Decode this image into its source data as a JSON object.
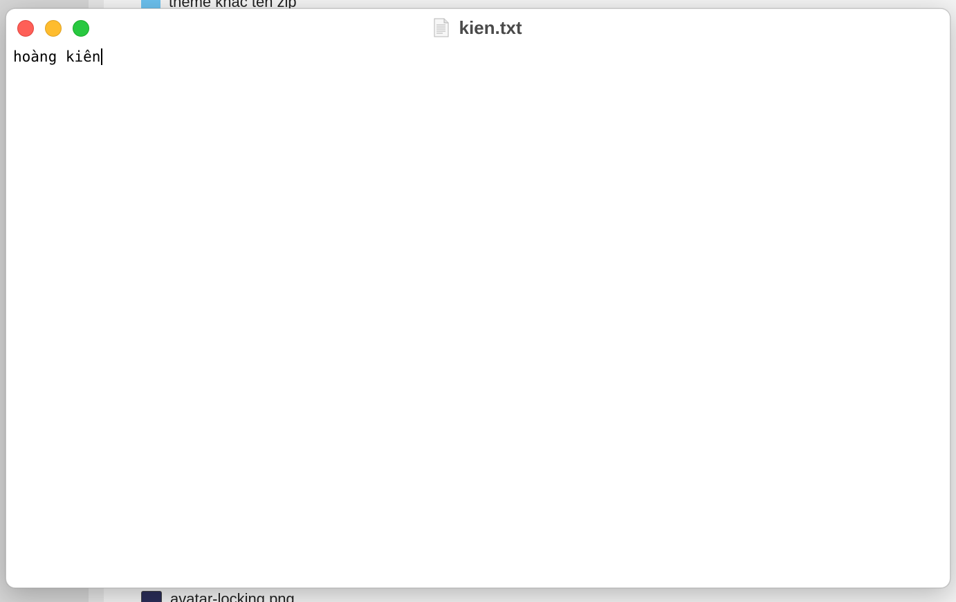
{
  "background_window": {
    "files": [
      {
        "name": "theme khác tên zip",
        "icon": "folder-icon"
      },
      {
        "name": "avatar-locking.png",
        "icon": "image-file-icon"
      }
    ]
  },
  "window": {
    "title": "kien.txt",
    "document_icon": "text-document-icon",
    "buttons": {
      "close": "close-button",
      "minimize": "minimize-button",
      "zoom": "zoom-button"
    }
  },
  "editor": {
    "content": "hoàng kiên"
  },
  "colors": {
    "close": "#fe5f57",
    "minimize": "#febc2e",
    "zoom": "#28c840"
  }
}
